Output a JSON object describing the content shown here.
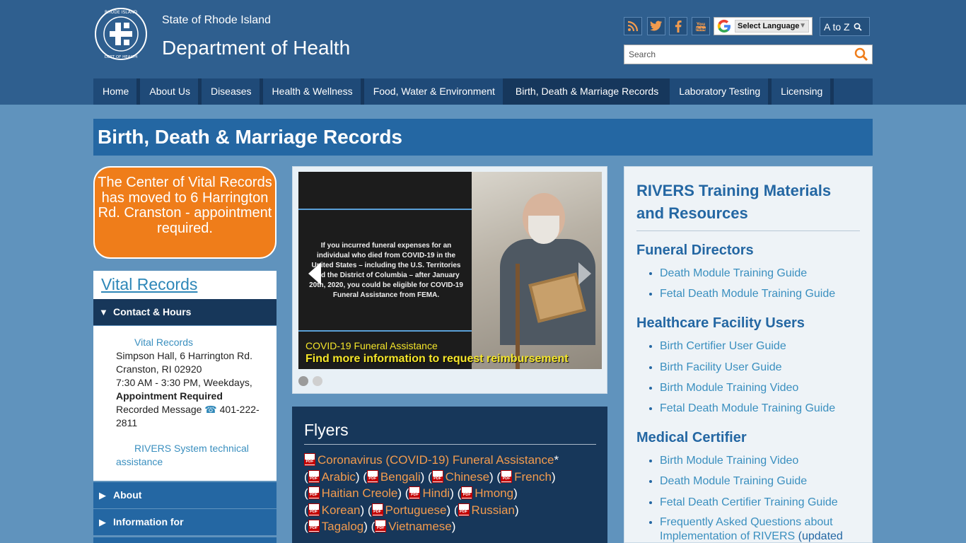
{
  "header": {
    "state": "State of Rhode Island",
    "department": "Department of Health",
    "language_select": "Select Language",
    "atoz": "A to Z",
    "search_placeholder": "Search"
  },
  "social_icons": [
    "rss-icon",
    "twitter-icon",
    "facebook-icon",
    "youtube-icon"
  ],
  "nav": [
    "Home",
    "About Us",
    "Diseases",
    "Health & Wellness",
    "Food, Water & Environment",
    "Birth, Death & Marriage Records",
    "Laboratory Testing",
    "Licensing"
  ],
  "page_title": "Birth, Death & Marriage Records",
  "callout": "The Center of Vital Records has moved to 6 Harrington Rd. Cranston - appointment required.",
  "sidebar": {
    "heading": "Vital Records",
    "contact_toggle": "Contact & Hours",
    "contact": {
      "name_link": "Vital Records",
      "address1": "Simpson Hall, 6 Harrington Rd.",
      "address2": "Cranston, RI 02920",
      "hours": "7:30 AM - 3:30 PM, Weekdays,",
      "appointment": "Appointment Required",
      "recorded_message": "Recorded Message",
      "phone": "401-222-2811",
      "rivers_link": "RIVERS System technical assistance"
    },
    "about": "About",
    "info_for": "Information for"
  },
  "slider": {
    "message": "If you incurred funeral expenses for an individual who died from COVID-19 in the United States – including the U.S. Territories and the District of Columbia – after January 20th, 2020, you could be eligible for COVID-19 Funeral Assistance from FEMA.",
    "caption_title": "COVID-19 Funeral Assistance",
    "caption_sub": "Find more information to request reimbursement"
  },
  "flyers": {
    "title": "Flyers",
    "main": "Coronavirus (COVID-19) Funeral Assistance",
    "main_suffix": "*",
    "languages": [
      "Arabic",
      "Bengali",
      "Chinese",
      "French",
      "Haitian Creole",
      "Hindi",
      "Hmong",
      "Korean",
      "Portuguese",
      "Russian",
      "Tagalog",
      "Vietnamese"
    ]
  },
  "rivers": {
    "title": "RIVERS Training Materials and Resources",
    "sections": [
      {
        "heading": "Funeral Directors",
        "items": [
          "Death Module Training Guide",
          "Fetal Death Module Training Guide"
        ]
      },
      {
        "heading": "Healthcare Facility Users",
        "items": [
          "Birth Certifier User Guide",
          "Birth Facility User Guide",
          "Birth Module Training Video",
          "Fetal Death Module Training Guide"
        ]
      },
      {
        "heading": "Medical Certifier",
        "items": [
          "Birth Module Training Video",
          "Death Module Training Guide",
          "Fetal Death Certifier Training Guide",
          "Frequently Asked Questions about Implementation of RIVERS"
        ]
      }
    ],
    "last_suffix": " (updated"
  },
  "colors": {
    "header_bg": "#2f5f8f",
    "nav_bg": "#1f4a78",
    "title_bg": "#2467a3",
    "callout_bg": "#ef7d1a",
    "flyer_link": "#f29b4e",
    "body_bg": "#6093bd"
  }
}
